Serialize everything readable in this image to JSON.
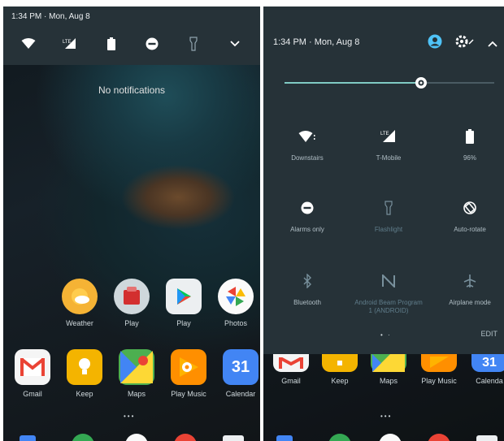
{
  "left": {
    "status_text": "1:34 PM · Mon, Aug 8",
    "no_notifications": "No notifications",
    "row1_apps": [
      {
        "label": "Weather"
      },
      {
        "label": "Play"
      },
      {
        "label": "Play"
      },
      {
        "label": "Photos"
      }
    ],
    "dock_apps": [
      {
        "label": "Gmail"
      },
      {
        "label": "Keep"
      },
      {
        "label": "Maps"
      },
      {
        "label": "Play Music"
      },
      {
        "label": "Calendar"
      }
    ],
    "calendar_day": "31",
    "page_dots": "•••"
  },
  "right": {
    "status_text": "1:34 PM · Mon, Aug 8",
    "tiles": [
      {
        "label": "Downstairs",
        "icon": "wifi-icon"
      },
      {
        "label": "T-Mobile",
        "icon": "signal-icon"
      },
      {
        "label": "96%",
        "icon": "battery-icon"
      },
      {
        "label": "Alarms only",
        "icon": "do-not-disturb-icon"
      },
      {
        "label": "Flashlight",
        "icon": "flashlight-icon"
      },
      {
        "label": "Auto-rotate",
        "icon": "rotate-icon"
      },
      {
        "label": "Bluetooth",
        "icon": "bluetooth-icon"
      },
      {
        "label": "Android Beam Program",
        "sublabel": "1 (ANDROID)",
        "icon": "nfc-icon"
      },
      {
        "label": "Airplane mode",
        "icon": "airplane-icon"
      }
    ],
    "edit_label": "EDIT",
    "pager_dots": "• ·",
    "dock_apps": [
      {
        "label": "Gmail"
      },
      {
        "label": "Keep"
      },
      {
        "label": "Maps"
      },
      {
        "label": "Play Music"
      },
      {
        "label": "Calenda"
      }
    ],
    "calendar_day": "31",
    "page_dots": "•••"
  },
  "brightness_level": 0.65,
  "colors": {
    "shade": "#263238",
    "accent": "#80cbc4",
    "account": "#4fc3f7",
    "gmail": "#ea4335",
    "keep": "#f4b400",
    "play_music": "#ff8f00",
    "calendar": "#4285f4"
  }
}
